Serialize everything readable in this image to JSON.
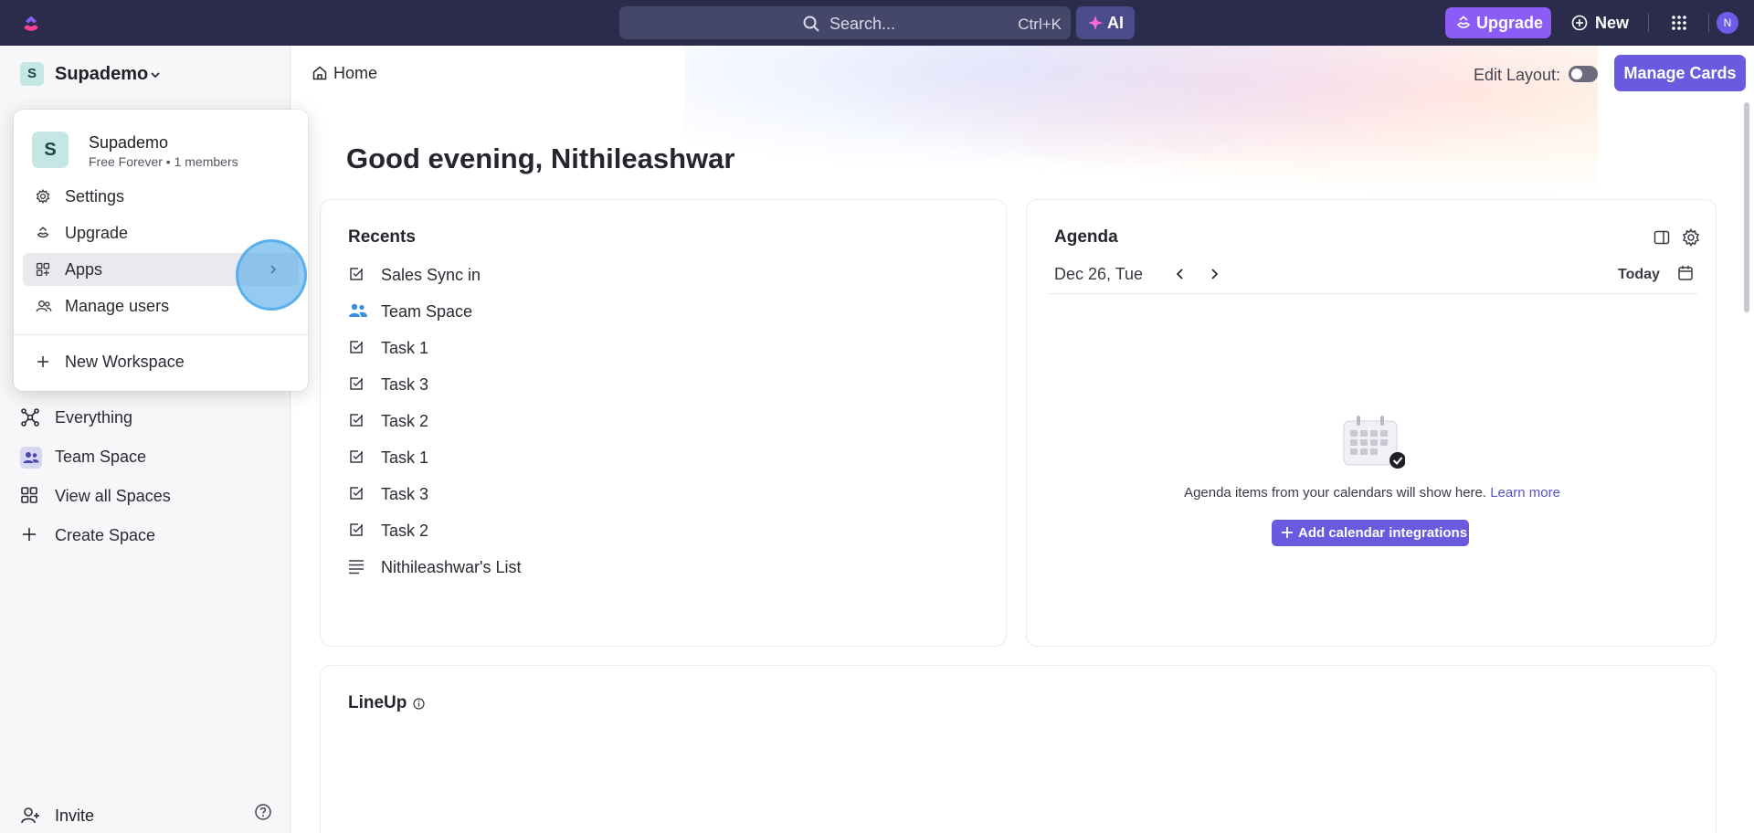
{
  "topbar": {
    "search_placeholder": "Search...",
    "search_shortcut": "Ctrl+K",
    "ai_label": "AI",
    "upgrade_label": "Upgrade",
    "new_label": "New",
    "avatar_initial": "N"
  },
  "sidebar": {
    "workspace_initial": "S",
    "workspace_name": "Supademo",
    "items": [
      {
        "label": "Everything",
        "icon": "everything-icon"
      },
      {
        "label": "Team Space",
        "icon": "team-space-icon"
      },
      {
        "label": "View all Spaces",
        "icon": "grid-icon"
      },
      {
        "label": "Create Space",
        "icon": "plus-icon"
      }
    ],
    "invite_label": "Invite"
  },
  "dropdown": {
    "avatar_initial": "S",
    "name": "Supademo",
    "subtitle": "Free Forever • 1 members",
    "items": [
      {
        "label": "Settings",
        "icon": "gear-icon"
      },
      {
        "label": "Upgrade",
        "icon": "upgrade-icon"
      },
      {
        "label": "Apps",
        "icon": "apps-icon",
        "active": true
      },
      {
        "label": "Manage users",
        "icon": "users-icon"
      }
    ],
    "new_workspace_label": "New Workspace"
  },
  "main": {
    "breadcrumb": "Home",
    "edit_layout_label": "Edit Layout:",
    "manage_cards_label": "Manage Cards",
    "greeting": "Good evening, Nithileashwar"
  },
  "recents": {
    "title": "Recents",
    "items": [
      {
        "label": "Sales Sync in",
        "icon": "task-icon"
      },
      {
        "label": "Team Space",
        "icon": "team-icon"
      },
      {
        "label": "Task 1",
        "icon": "task-icon"
      },
      {
        "label": "Task 3",
        "icon": "task-icon"
      },
      {
        "label": "Task 2",
        "icon": "task-icon"
      },
      {
        "label": "Task 1",
        "icon": "task-icon"
      },
      {
        "label": "Task 3",
        "icon": "task-icon"
      },
      {
        "label": "Task 2",
        "icon": "task-icon"
      },
      {
        "label": "Nithileashwar's List",
        "icon": "list-icon"
      }
    ]
  },
  "agenda": {
    "title": "Agenda",
    "date": "Dec 26, Tue",
    "today_label": "Today",
    "empty_message": "Agenda items from your calendars will show here.",
    "learn_more": "Learn more",
    "add_button": "Add calendar integrations"
  },
  "lineup": {
    "title": "LineUp"
  },
  "colors": {
    "topbar_bg": "#2b2c4c",
    "accent": "#6a5ae0",
    "upgrade_bg": "#8b5cf6",
    "workspace_avatar_bg": "#c4e6e4"
  }
}
